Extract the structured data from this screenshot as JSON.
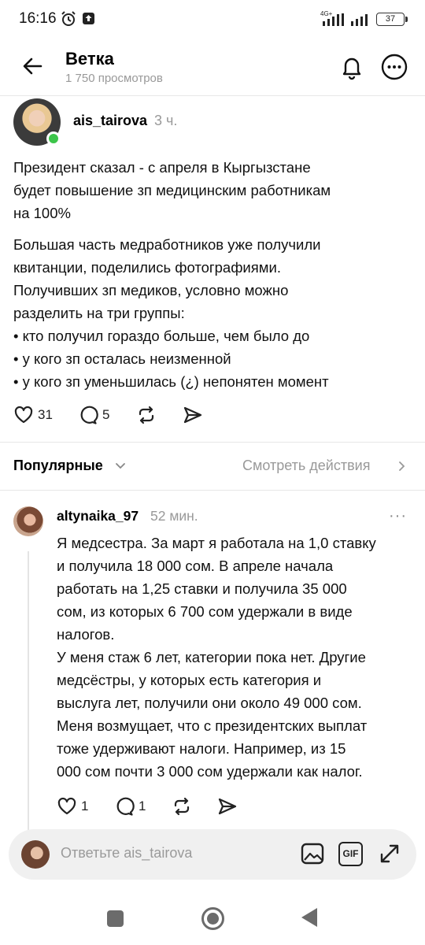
{
  "status_bar": {
    "time": "16:16",
    "network": "4G+",
    "battery": "37"
  },
  "header": {
    "title": "Ветка",
    "views": "1 750 просмотров"
  },
  "post": {
    "username": "ais_tairova",
    "time": "3 ч.",
    "paragraph1": [
      "Президент сказал - с апреля в Кыргызстане",
      "будет повышение зп медицинским работникам",
      "на 100%"
    ],
    "paragraph2": [
      "Большая часть медработников уже получили",
      "квитанции, поделились фотографиями.",
      "Получивших зп медиков, условно можно",
      "разделить на три группы:",
      "• кто получил гораздо больше, чем было до",
      "• у кого зп осталась неизменной",
      "• у кого зп уменьшилась (¿) непонятен момент"
    ],
    "likes": "31",
    "comments": "5"
  },
  "sort_bar": {
    "sort_label": "Популярные",
    "view_activity": "Смотреть действия"
  },
  "reply": {
    "username": "altynaika_97",
    "time": "52 мин.",
    "more": "···",
    "text": [
      "Я медсестра. За март я работала на 1,0 ставку",
      "и получила 18 000 сом. В апреле начала",
      "работать на 1,25 ставки и получила 35 000",
      "сом, из которых 6 700 сом удержали в виде",
      "налогов.",
      "У меня стаж 6 лет, категории пока нет. Другие",
      "медсёстры, у которых есть категория и",
      "выслуга лет, получили они около 49 000 сом.",
      "Меня возмущает, что с президентских выплат",
      "тоже удерживают налоги. Например, из 15",
      "000 сом почти 3 000 сом удержали как налог."
    ],
    "likes": "1",
    "comments": "1"
  },
  "composer": {
    "placeholder": "Ответьте ais_tairova",
    "gif_label": "GIF"
  },
  "icons": {
    "back": "arrow-left-icon",
    "notifications": "bell-icon",
    "more": "more-circle-icon",
    "like": "heart-icon",
    "comment": "comment-bubble-icon",
    "repost": "repost-icon",
    "share": "send-icon",
    "image": "image-icon",
    "gif": "gif-icon",
    "expand": "expand-icon"
  }
}
